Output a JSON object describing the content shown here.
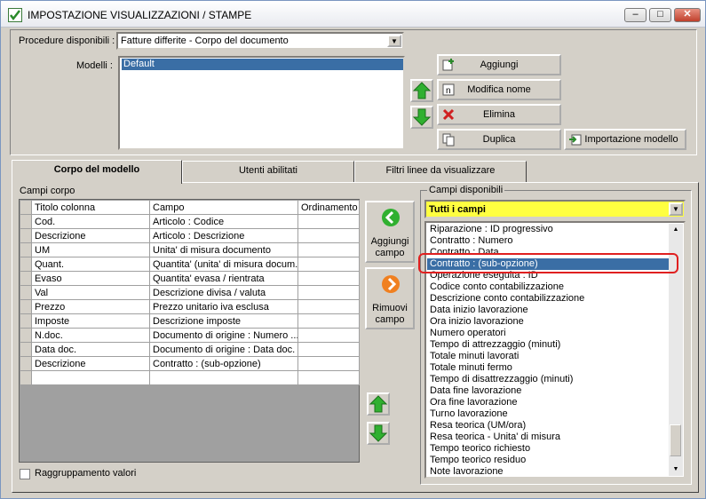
{
  "window": {
    "title": "IMPOSTAZIONE VISUALIZZAZIONI / STAMPE",
    "minimize": "–",
    "maximize": "□",
    "close": "✕"
  },
  "procedure": {
    "label": "Procedure disponibili :",
    "value": "Fatture differite - Corpo del documento"
  },
  "modelli": {
    "label": "Modelli :",
    "items": [
      "Default"
    ]
  },
  "buttons": {
    "aggiungi": "Aggiungi",
    "modifica_nome": "Modifica nome",
    "elimina": "Elimina",
    "duplica": "Duplica",
    "importazione": "Importazione modello",
    "aggiungi_campo": "Aggiungi campo",
    "rimuovi_campo": "Rimuovi campo"
  },
  "tabs": [
    {
      "label": "Corpo del modello",
      "active": true
    },
    {
      "label": "Utenti abilitati",
      "active": false
    },
    {
      "label": "Filtri linee da visualizzare",
      "active": false
    }
  ],
  "campi_corpo": {
    "label": "Campi corpo",
    "headers": [
      "Titolo colonna",
      "Campo",
      "Ordinamento"
    ],
    "rows": [
      [
        "Cod.",
        "Articolo : Codice",
        ""
      ],
      [
        "Descrizione",
        "Articolo : Descrizione",
        ""
      ],
      [
        "UM",
        "Unita' di misura documento",
        ""
      ],
      [
        "Quant.",
        "Quantita' (unita' di misura docum...",
        ""
      ],
      [
        "Evaso",
        "Quantita' evasa / rientrata",
        ""
      ],
      [
        "Val",
        "Descrizione divisa / valuta",
        ""
      ],
      [
        "Prezzo",
        "Prezzo unitario iva esclusa",
        ""
      ],
      [
        "Imposte",
        "Descrizione imposte",
        ""
      ],
      [
        "N.doc.",
        "Documento di origine : Numero ...",
        ""
      ],
      [
        "Data doc.",
        "Documento di origine : Data doc.",
        ""
      ],
      [
        "Descrizione",
        "Contratto : (sub-opzione)",
        ""
      ],
      [
        "",
        "",
        ""
      ]
    ]
  },
  "raggruppamento": {
    "label": "Raggruppamento valori",
    "checked": false
  },
  "campi_disponibili": {
    "label": "Campi disponibili",
    "filter": "Tutti i campi",
    "items": [
      "Riparazione : ID progressivo",
      "Contratto : Numero",
      "Contratto : Data",
      "Contratto : (sub-opzione)",
      "Operazione eseguita : ID",
      "Codice conto contabilizzazione",
      "Descrizione conto contabilizzazione",
      "Data inizio lavorazione",
      "Ora inizio lavorazione",
      "Numero operatori",
      "Tempo di attrezzaggio (minuti)",
      "Totale minuti lavorati",
      "Totale minuti fermo",
      "Tempo di disattrezzaggio (minuti)",
      "Data fine lavorazione",
      "Ora fine lavorazione",
      "Turno lavorazione",
      "Resa teorica (UM/ora)",
      "Resa teorica - Unita' di misura",
      "Tempo teorico richiesto",
      "Tempo teorico residuo",
      "Note lavorazione"
    ],
    "selected_index": 3
  },
  "colors": {
    "selection": "#3a6ea5",
    "filter_bg": "#ffff40",
    "highlight_ring": "#e02020",
    "arrow_green": "#30b030",
    "remove_orange": "#f08020"
  }
}
